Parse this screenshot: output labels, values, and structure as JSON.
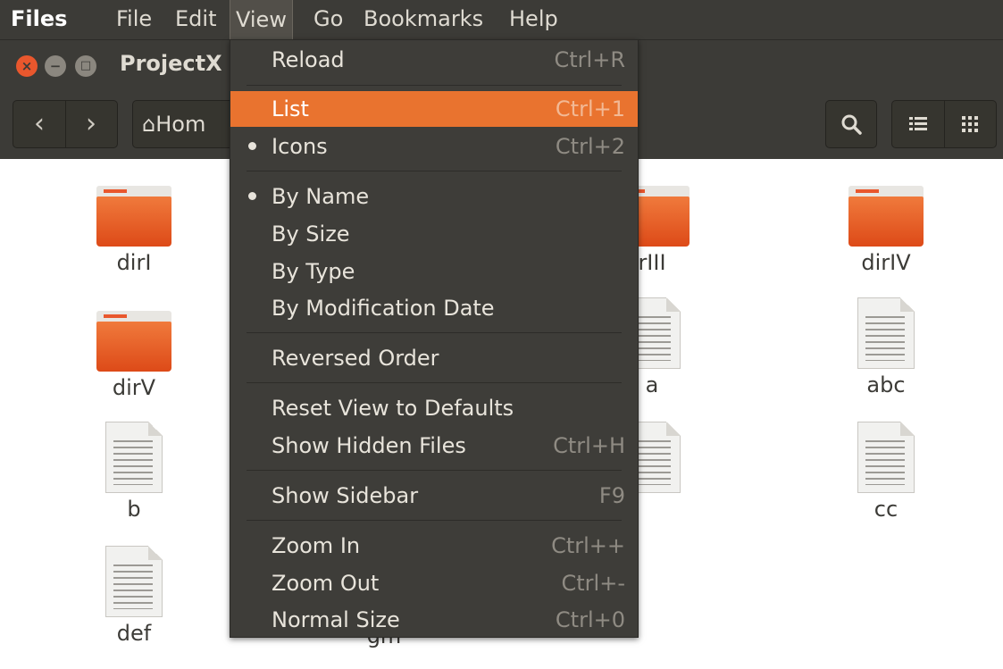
{
  "menubar": {
    "app": "Files",
    "items": [
      "File",
      "Edit",
      "View",
      "Go",
      "Bookmarks",
      "Help"
    ]
  },
  "window": {
    "title": "ProjectX",
    "path_label": "Hom"
  },
  "files": [
    {
      "name": "dirI",
      "type": "folder"
    },
    {
      "name": "dirIV",
      "type": "folder"
    },
    {
      "name": "dirV",
      "type": "folder"
    },
    {
      "name": "abc",
      "type": "document"
    },
    {
      "name": "b",
      "type": "document"
    },
    {
      "name": "cc",
      "type": "document"
    },
    {
      "name": "def",
      "type": "document"
    },
    {
      "name": "gm",
      "type": "document"
    },
    {
      "name": "rIII",
      "type": "folder"
    },
    {
      "name": "a",
      "type": "document"
    }
  ],
  "view_menu": {
    "items": [
      {
        "label": "Reload",
        "accel": "Ctrl+R"
      },
      {
        "label": "List",
        "accel": "Ctrl+1",
        "highlighted": true
      },
      {
        "label": "Icons",
        "accel": "Ctrl+2",
        "checked": true
      },
      {
        "label": "By Name",
        "accel": "",
        "checked": true
      },
      {
        "label": "By Size",
        "accel": ""
      },
      {
        "label": "By Type",
        "accel": ""
      },
      {
        "label": "By Modification Date",
        "accel": ""
      },
      {
        "label": "Reversed Order",
        "accel": ""
      },
      {
        "label": "Reset View to Defaults",
        "accel": ""
      },
      {
        "label": "Show Hidden Files",
        "accel": "Ctrl+H"
      },
      {
        "label": "Show Sidebar",
        "accel": "F9"
      },
      {
        "label": "Zoom In",
        "accel": "Ctrl++"
      },
      {
        "label": "Zoom Out",
        "accel": "Ctrl+-"
      },
      {
        "label": "Normal Size",
        "accel": "Ctrl+0"
      }
    ]
  },
  "colors": {
    "accent": "#e9732f",
    "chrome": "#3c3b37",
    "folder": "#e9572d"
  }
}
